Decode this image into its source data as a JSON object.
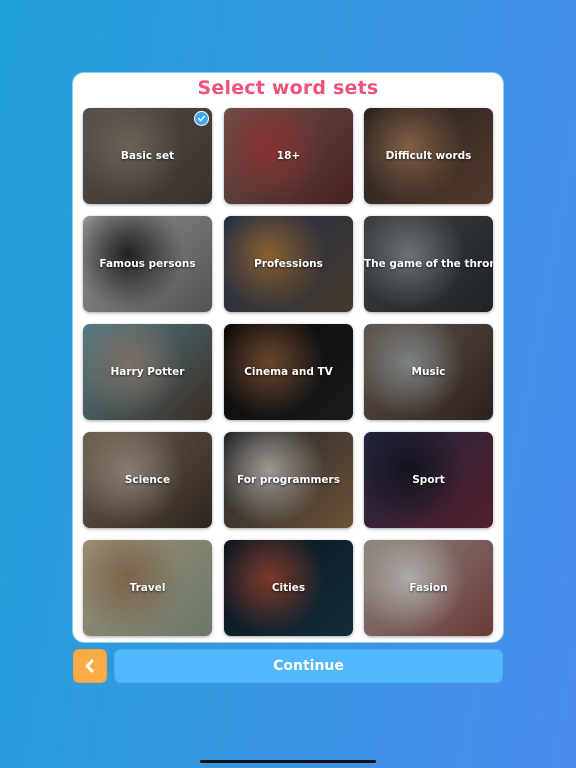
{
  "title": "Select word sets",
  "word_sets": [
    {
      "label": "Basic set",
      "selected": true,
      "image": "stacked open books",
      "colors": [
        "#6e645c",
        "#4a3f38",
        "#8a7d70"
      ]
    },
    {
      "label": "18+",
      "selected": false,
      "image": "red lips with ring",
      "colors": [
        "#8a6a60",
        "#5a2a2a",
        "#b04040"
      ]
    },
    {
      "label": "Difficult words",
      "selected": false,
      "image": "jenga tower",
      "colors": [
        "#2f2a28",
        "#6a4a38",
        "#a57a58"
      ]
    },
    {
      "label": "Famous persons",
      "selected": false,
      "image": "mustached man portrait",
      "colors": [
        "#bdbdbd",
        "#6a6a6a",
        "#2a2a2a"
      ]
    },
    {
      "label": "Professions",
      "selected": false,
      "image": "welder at dusk",
      "colors": [
        "#2a3a5a",
        "#5a4a3a",
        "#b07a40"
      ]
    },
    {
      "label": "The game of the thrones",
      "selected": false,
      "image": "dragon and queen",
      "colors": [
        "#4a5054",
        "#2a2e32",
        "#8a9094"
      ]
    },
    {
      "label": "Harry Potter",
      "selected": false,
      "image": "boy with glasses",
      "colors": [
        "#6aa0b0",
        "#4a3a30",
        "#a09080"
      ]
    },
    {
      "label": "Cinema and TV",
      "selected": false,
      "image": "godfather with cat",
      "colors": [
        "#0e0e0e",
        "#222222",
        "#8a5a38"
      ]
    },
    {
      "label": "Music",
      "selected": false,
      "image": "acoustic guitar",
      "colors": [
        "#7a6a60",
        "#3a2a22",
        "#a0a8a8"
      ]
    },
    {
      "label": "Science",
      "selected": false,
      "image": "scientist portrait",
      "colors": [
        "#8a7a68",
        "#3a2e26",
        "#b0a090"
      ]
    },
    {
      "label": "For programmers",
      "selected": false,
      "image": "laptop and coffee",
      "colors": [
        "#2a2e34",
        "#8a6a48",
        "#c8c4bc"
      ]
    },
    {
      "label": "Sport",
      "selected": false,
      "image": "footballer",
      "colors": [
        "#2a3050",
        "#6a2838",
        "#1a1a28"
      ]
    },
    {
      "label": "Travel",
      "selected": false,
      "image": "map with camera",
      "colors": [
        "#c8b898",
        "#8a9a88",
        "#a08060"
      ]
    },
    {
      "label": "Cities",
      "selected": false,
      "image": "cathedral at night",
      "colors": [
        "#0e1a28",
        "#1a3a48",
        "#a04a38"
      ]
    },
    {
      "label": "Fasion",
      "selected": false,
      "image": "man in suit",
      "colors": [
        "#b0a8a0",
        "#8a4a48",
        "#e0dcd8"
      ]
    }
  ],
  "footer": {
    "back_icon": "chevron-left-icon",
    "continue_label": "Continue"
  },
  "colors": {
    "title": "#f0527a",
    "check": "#3ea8f0",
    "back_button": "#fbac47",
    "continue_button": "#52b8fc"
  }
}
